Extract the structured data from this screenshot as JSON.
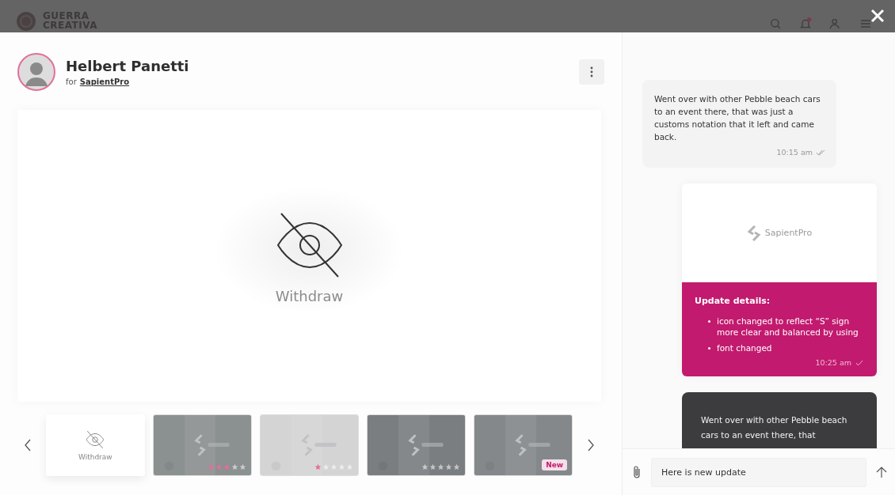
{
  "background_header": {
    "logo_lines": [
      "GUERRA",
      "CREATIVA"
    ]
  },
  "author": {
    "name": "Helbert Panetti",
    "for_label": "for",
    "company": "SapientPro"
  },
  "preview": {
    "status": "Withdraw"
  },
  "thumbnails": [
    {
      "kind": "withdraw",
      "label": "Withdraw",
      "selected": true
    },
    {
      "stars": 3,
      "selected": false
    },
    {
      "kind": "picture",
      "stars": 1,
      "selected": false
    },
    {
      "kind": "picture",
      "stars": 0,
      "selected": false
    },
    {
      "badge": "New",
      "selected": false
    }
  ],
  "messages": [
    {
      "kind": "bubble",
      "text": "Went over with other Pebble beach cars to an event there, that was just a customs notation that it left and came back.",
      "time": "10:15 am",
      "read": true
    },
    {
      "kind": "update",
      "logo": "SapientPro",
      "title": "Update details:",
      "items": [
        "icon changed to reflect “S” sign more clear and balanced by using",
        "font changed"
      ],
      "time": "10:25 am",
      "read": false
    },
    {
      "kind": "dark",
      "text": "Went over with other Pebble beach cars to an event there, that"
    }
  ],
  "composer": {
    "value": "Here is new update"
  }
}
